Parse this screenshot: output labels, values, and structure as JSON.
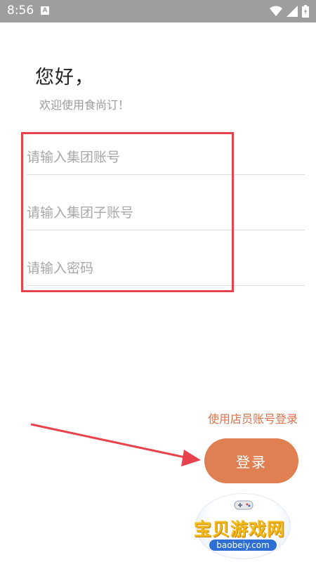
{
  "status_bar": {
    "time": "8:56",
    "notification_icon": "a-icon",
    "icons": [
      "wifi-icon",
      "signal-icon",
      "battery-icon"
    ]
  },
  "greeting": {
    "title": "您好，",
    "subtitle": "欢迎使用食尚订！"
  },
  "form": {
    "group_account_placeholder": "请输入集团账号",
    "sub_account_placeholder": "请输入集团子账号",
    "password_placeholder": "请输入密码"
  },
  "actions": {
    "store_login_link": "使用店员账号登录",
    "login_button": "登录"
  },
  "watermark": {
    "brand": "宝贝游戏网",
    "url": "baobeiy.com"
  },
  "colors": {
    "accent": "#df7f52",
    "annotation": "#e8424c",
    "status_bar": "#9e9e9e"
  }
}
